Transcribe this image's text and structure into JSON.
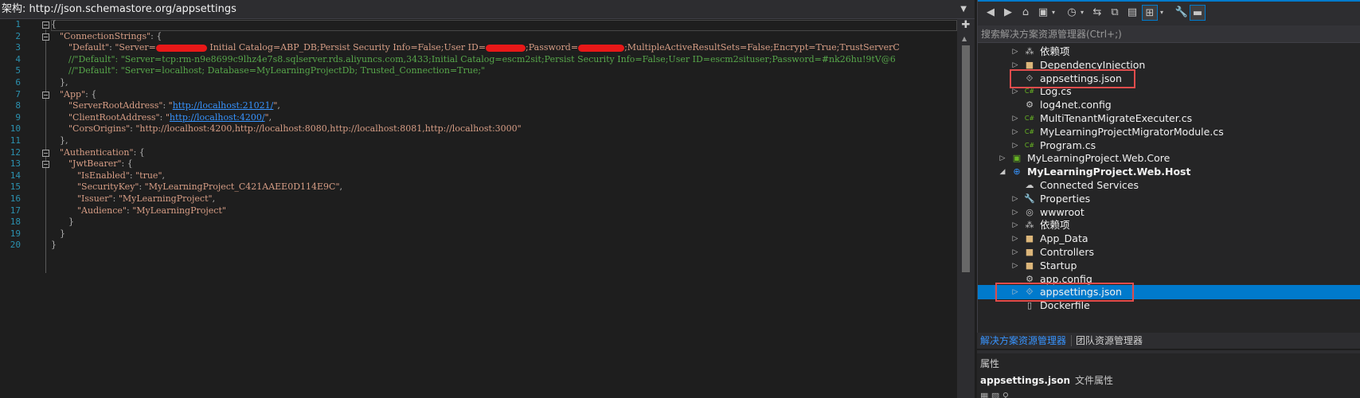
{
  "editor": {
    "schema_label": "架构:",
    "schema_url": "http://json.schemastore.org/appsettings",
    "lines": [
      {
        "n": "1",
        "html": "<span class='p'>{</span>"
      },
      {
        "n": "2",
        "html": "<span class='k'>\"ConnectionStrings\"</span><span class='p'>: {</span>"
      },
      {
        "n": "3",
        "html": "<span class='k'>\"Default\"</span><span class='p'>: </span><span class='s'>\"Server=<span class='red' style='width:64px'></span> Initial Catalog=ABP_DB;Persist Security Info=False;User ID=<span class='red' style='width:50px'></span>;Password=<span class='red' style='width:58px'></span>;MultipleActiveResultSets=False;Encrypt=True;TrustServerC</span>"
      },
      {
        "n": "4",
        "html": "<span class='c'>//\"Default\": \"Server=tcp:rm-n9e8699c9lhz4e7s8.sqlserver.rds.aliyuncs.com,3433;Initial Catalog=escm2sit;Persist Security Info=False;User ID=escm2situser;Password=#nk26hu!9tV@6</span>"
      },
      {
        "n": "5",
        "html": "<span class='c'>//\"Default\": \"Server=localhost; Database=MyLearningProjectDb; Trusted_Connection=True;\"</span>"
      },
      {
        "n": "6",
        "html": "<span class='p'>},</span>"
      },
      {
        "n": "7",
        "html": "<span class='k'>\"App\"</span><span class='p'>: {</span>"
      },
      {
        "n": "8",
        "html": "<span class='k'>\"ServerRootAddress\"</span><span class='p'>: </span><span class='s'>\"<span class='url'>http://localhost:21021/</span>\"</span><span class='p'>,</span>"
      },
      {
        "n": "9",
        "html": "<span class='k'>\"ClientRootAddress\"</span><span class='p'>: </span><span class='s'>\"<span class='url'>http://localhost:4200/</span>\"</span><span class='p'>,</span>"
      },
      {
        "n": "10",
        "html": "<span class='k'>\"CorsOrigins\"</span><span class='p'>: </span><span class='s'>\"http://localhost:4200,http://localhost:8080,http://localhost:8081,http://localhost:3000\"</span>"
      },
      {
        "n": "11",
        "html": "<span class='p'>},</span>"
      },
      {
        "n": "12",
        "html": "<span class='k'>\"Authentication\"</span><span class='p'>: {</span>"
      },
      {
        "n": "13",
        "html": "<span class='k'>\"JwtBearer\"</span><span class='p'>: {</span>"
      },
      {
        "n": "14",
        "html": "<span class='k'>\"IsEnabled\"</span><span class='p'>: </span><span class='s'>\"true\"</span><span class='p'>,</span>"
      },
      {
        "n": "15",
        "html": "<span class='k'>\"SecurityKey\"</span><span class='p'>: </span><span class='s'>\"MyLearningProject_C421AAEE0D114E9C\"</span><span class='p'>,</span>"
      },
      {
        "n": "16",
        "html": "<span class='k'>\"Issuer\"</span><span class='p'>: </span><span class='s'>\"MyLearningProject\"</span><span class='p'>,</span>"
      },
      {
        "n": "17",
        "html": "<span class='k'>\"Audience\"</span><span class='p'>: </span><span class='s'>\"MyLearningProject\"</span>"
      },
      {
        "n": "18",
        "html": "<span class='p'>}</span>"
      },
      {
        "n": "19",
        "html": "<span class='p'>}</span>"
      },
      {
        "n": "20",
        "html": "<span class='p'>}</span>"
      }
    ]
  },
  "solution_explorer": {
    "search_placeholder": "搜索解决方案资源管理器(Ctrl+;)",
    "toolbar_icons": [
      "back-icon",
      "forward-icon",
      "home-icon",
      "switch-views-icon",
      "dropdown-icon",
      "pending-changes-icon",
      "sync-icon",
      "collapse-all-icon",
      "show-all-files-icon",
      "track-active-icon",
      "dropdown-icon",
      "properties-wrench-icon",
      "preview-icon"
    ],
    "items": [
      {
        "label": "依赖项",
        "icon": "dependencies-icon",
        "expander": "▷",
        "bold": false,
        "selected": false
      },
      {
        "label": "DependencyInjection",
        "icon": "folder-icon",
        "expander": "▷",
        "bold": false,
        "selected": false
      },
      {
        "label": "appsettings.json",
        "icon": "json-file-icon",
        "expander": "",
        "bold": false,
        "selected": false
      },
      {
        "label": "Log.cs",
        "icon": "csharp-file-icon",
        "expander": "▷",
        "bold": false,
        "selected": false
      },
      {
        "label": "log4net.config",
        "icon": "config-file-icon",
        "expander": "",
        "bold": false,
        "selected": false
      },
      {
        "label": "MultiTenantMigrateExecuter.cs",
        "icon": "csharp-file-icon",
        "expander": "▷",
        "bold": false,
        "selected": false
      },
      {
        "label": "MyLearningProjectMigratorModule.cs",
        "icon": "csharp-file-icon",
        "expander": "▷",
        "bold": false,
        "selected": false
      },
      {
        "label": "Program.cs",
        "icon": "csharp-file-icon",
        "expander": "▷",
        "bold": false,
        "selected": false
      },
      {
        "label": "MyLearningProject.Web.Core",
        "icon": "csharp-project-icon",
        "expander": "▷",
        "bold": false,
        "selected": false
      },
      {
        "label": "MyLearningProject.Web.Host",
        "icon": "web-project-icon",
        "expander": "◢",
        "bold": true,
        "selected": false
      },
      {
        "label": "Connected Services",
        "icon": "connected-services-icon",
        "expander": "",
        "bold": false,
        "selected": false
      },
      {
        "label": "Properties",
        "icon": "wrench-icon",
        "expander": "▷",
        "bold": false,
        "selected": false
      },
      {
        "label": "wwwroot",
        "icon": "globe-icon",
        "expander": "▷",
        "bold": false,
        "selected": false
      },
      {
        "label": "依赖项",
        "icon": "dependencies-icon",
        "expander": "▷",
        "bold": false,
        "selected": false
      },
      {
        "label": "App_Data",
        "icon": "folder-icon",
        "expander": "▷",
        "bold": false,
        "selected": false
      },
      {
        "label": "Controllers",
        "icon": "folder-icon",
        "expander": "▷",
        "bold": false,
        "selected": false
      },
      {
        "label": "Startup",
        "icon": "folder-icon",
        "expander": "▷",
        "bold": false,
        "selected": false
      },
      {
        "label": "app.config",
        "icon": "config-file-icon",
        "expander": "",
        "bold": false,
        "selected": false
      },
      {
        "label": "appsettings.json",
        "icon": "json-file-icon",
        "expander": "▷",
        "bold": false,
        "selected": true
      },
      {
        "label": "Dockerfile",
        "icon": "file-icon",
        "expander": "",
        "bold": false,
        "selected": false
      }
    ],
    "tabs": [
      "解决方案资源管理器",
      "团队资源管理器"
    ]
  },
  "properties": {
    "header": "属性",
    "object_name": "appsettings.json",
    "object_type": "文件属性"
  },
  "colors": {
    "accent": "#007acc",
    "highlight_box": "#e04c4c",
    "redaction": "#e81818"
  }
}
